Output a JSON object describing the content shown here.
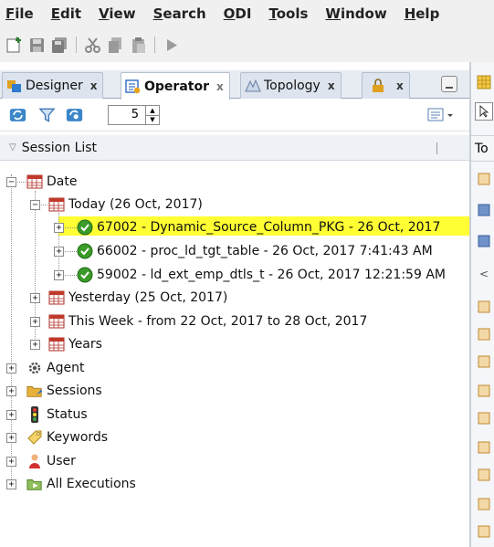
{
  "menubar": {
    "items": [
      {
        "label": "File",
        "u": "F",
        "rest": "ile"
      },
      {
        "label": "Edit",
        "u": "E",
        "rest": "dit"
      },
      {
        "label": "View",
        "u": "V",
        "rest": "iew"
      },
      {
        "label": "Search",
        "u": "S",
        "rest": "earch"
      },
      {
        "label": "ODI",
        "u": "O",
        "rest": "DI"
      },
      {
        "label": "Tools",
        "u": "T",
        "rest": "ools"
      },
      {
        "label": "Window",
        "u": "W",
        "rest": "indow"
      },
      {
        "label": "Help",
        "u": "H",
        "rest": "elp"
      }
    ]
  },
  "tabs": {
    "designer": {
      "label": "Designer",
      "close": "x"
    },
    "operator": {
      "label": "Operator",
      "close": "x"
    },
    "topology": {
      "label": "Topology",
      "close": "x"
    },
    "security": {
      "close": "x"
    }
  },
  "session_toolbar": {
    "count_value": "5"
  },
  "session_list": {
    "title": "Session List"
  },
  "tree": {
    "date": "Date",
    "today": "Today (26 Oct, 2017)",
    "session1": "67002 - Dynamic_Source_Column_PKG - 26 Oct, 2017",
    "session2": "66002 - proc_ld_tgt_table - 26 Oct, 2017 7:41:43 AM",
    "session3": "59002 - ld_ext_emp_dtls_t - 26 Oct, 2017 12:21:59 AM",
    "yesterday": "Yesterday (25 Oct, 2017)",
    "this_week": "This Week - from 22 Oct, 2017 to 28 Oct, 2017",
    "years": "Years",
    "agent": "Agent",
    "sessions": "Sessions",
    "status": "Status",
    "keywords": "Keywords",
    "user": "User",
    "all_executions": "All Executions"
  },
  "right_pane": {
    "header_fragment": "To"
  },
  "colors": {
    "highlight": "#ffff33",
    "success": "#3a9a2a",
    "tab_bg": "#e7ecf3"
  }
}
